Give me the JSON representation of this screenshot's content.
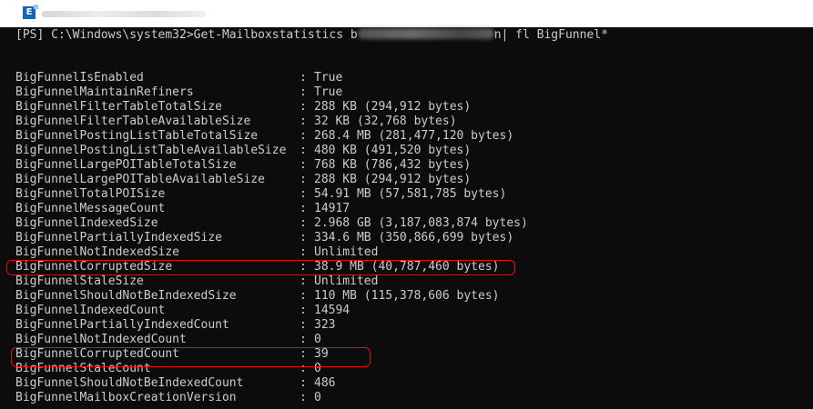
{
  "command": {
    "prompt": "[PS] C:\\Windows\\system32>",
    "cmdlet": "Get-Mailboxstatistics ",
    "prefix": "b",
    "suffix": "n",
    "pipe": "| fl BigFunnel*"
  },
  "rows": [
    {
      "key": "BigFunnelIsEnabled",
      "value": "True"
    },
    {
      "key": "BigFunnelMaintainRefiners",
      "value": "True"
    },
    {
      "key": "BigFunnelFilterTableTotalSize",
      "value": "288 KB (294,912 bytes)"
    },
    {
      "key": "BigFunnelFilterTableAvailableSize",
      "value": "32 KB (32,768 bytes)"
    },
    {
      "key": "BigFunnelPostingListTableTotalSize",
      "value": "268.4 MB (281,477,120 bytes)"
    },
    {
      "key": "BigFunnelPostingListTableAvailableSize",
      "value": "480 KB (491,520 bytes)"
    },
    {
      "key": "BigFunnelLargePOITableTotalSize",
      "value": "768 KB (786,432 bytes)"
    },
    {
      "key": "BigFunnelLargePOITableAvailableSize",
      "value": "288 KB (294,912 bytes)"
    },
    {
      "key": "BigFunnelTotalPOISize",
      "value": "54.91 MB (57,581,785 bytes)"
    },
    {
      "key": "BigFunnelMessageCount",
      "value": "14917"
    },
    {
      "key": "BigFunnelIndexedSize",
      "value": "2.968 GB (3,187,083,874 bytes)"
    },
    {
      "key": "BigFunnelPartiallyIndexedSize",
      "value": "334.6 MB (350,866,699 bytes)"
    },
    {
      "key": "BigFunnelNotIndexedSize",
      "value": "Unlimited"
    },
    {
      "key": "BigFunnelCorruptedSize",
      "value": "38.9 MB (40,787,460 bytes)"
    },
    {
      "key": "BigFunnelStaleSize",
      "value": "Unlimited"
    },
    {
      "key": "BigFunnelShouldNotBeIndexedSize",
      "value": "110 MB (115,378,606 bytes)"
    },
    {
      "key": "BigFunnelIndexedCount",
      "value": "14594"
    },
    {
      "key": "BigFunnelPartiallyIndexedCount",
      "value": "323"
    },
    {
      "key": "BigFunnelNotIndexedCount",
      "value": "0"
    },
    {
      "key": "BigFunnelCorruptedCount",
      "value": "39"
    },
    {
      "key": "BigFunnelStaleCount",
      "value": "0"
    },
    {
      "key": "BigFunnelShouldNotBeIndexedCount",
      "value": "486"
    },
    {
      "key": "BigFunnelMailboxCreationVersion",
      "value": "0"
    }
  ],
  "separator": ":",
  "colors": {
    "console_bg": "#0c0c0c",
    "console_text": "#cccccc",
    "highlight": "#e01010",
    "app_icon": "#1565c0"
  },
  "icons": {
    "app": "exchange-management-shell-icon"
  }
}
